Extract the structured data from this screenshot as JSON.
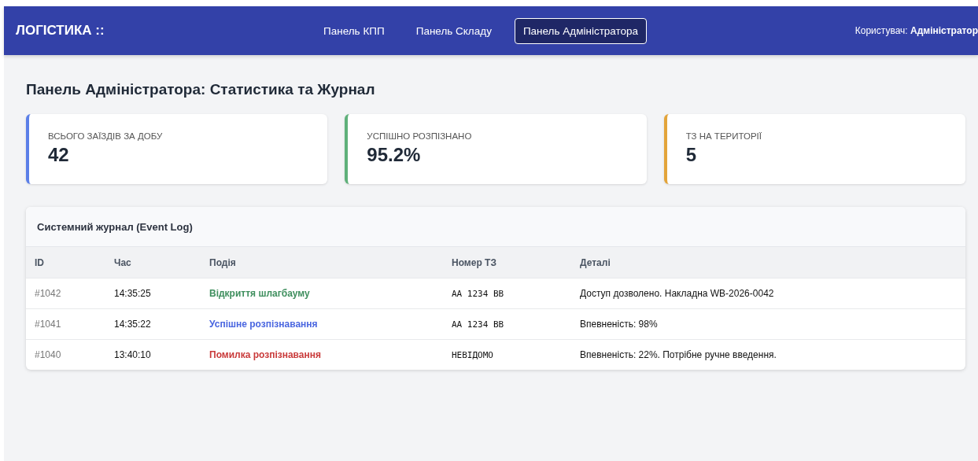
{
  "header": {
    "brand": "ЛОГІСТИКА ::",
    "nav": [
      {
        "label": "Панель КПП",
        "selected": false
      },
      {
        "label": "Панель Складу",
        "selected": false
      },
      {
        "label": "Панель Адміністратора",
        "selected": true
      }
    ],
    "user_label": "Користувач:",
    "user_name": "Адміністратор"
  },
  "page_title": "Панель Адміністратора: Статистика та Журнал",
  "stats": [
    {
      "label": "ВСЬОГО ЗАЇЗДІВ ЗА ДОБУ",
      "value": "42",
      "color": "#5b7fe8"
    },
    {
      "label": "УСПІШНО РОЗПІЗНАНО",
      "value": "95.2%",
      "color": "#5fb07a"
    },
    {
      "label": "ТЗ НА ТЕРИТОРІЇ",
      "value": "5",
      "color": "#e3a43a"
    }
  ],
  "event_log": {
    "title": "Системний журнал (Event Log)",
    "columns": [
      "ID",
      "Час",
      "Подія",
      "Номер ТЗ",
      "Деталі"
    ],
    "rows": [
      {
        "id": "#1042",
        "time": "14:35:25",
        "event": "Відкриття шлагбауму",
        "kind": "success",
        "plate": "AA 1234 BB",
        "details": "Доступ дозволено. Накладна WB-2026-0042"
      },
      {
        "id": "#1041",
        "time": "14:35:22",
        "event": "Успішне розпізнавання",
        "kind": "info",
        "plate": "AA 1234 BB",
        "details": "Впевненість: 98%"
      },
      {
        "id": "#1040",
        "time": "13:40:10",
        "event": "Помилка розпізнавання",
        "kind": "error",
        "plate": "НЕВІДОМО",
        "details": "Впевненість: 22%. Потрібне ручне введення."
      }
    ]
  }
}
